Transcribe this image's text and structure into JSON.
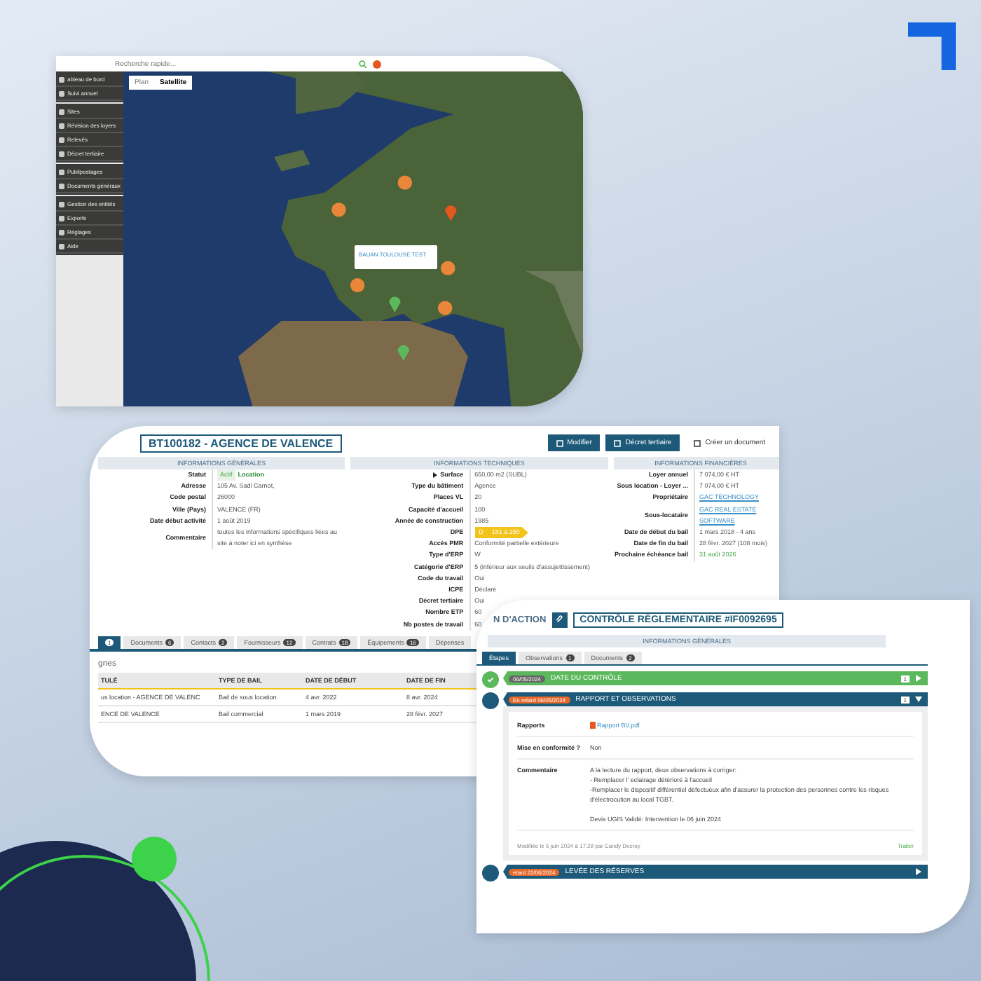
{
  "map_panel": {
    "search": {
      "placeholder": "Recherche rapide..."
    },
    "sidebar_groups": [
      {
        "items": [
          {
            "label": "ableau de bord"
          },
          {
            "label": "Suivi annuel"
          }
        ]
      },
      {
        "items": [
          {
            "label": "Sites"
          },
          {
            "label": "Révision des loyers"
          },
          {
            "label": "Relevés"
          },
          {
            "label": "Décret tertiaire"
          }
        ]
      },
      {
        "items": [
          {
            "label": "Publipostages"
          },
          {
            "label": "Documents généraux"
          }
        ]
      },
      {
        "items": [
          {
            "label": "Gestion des entités"
          },
          {
            "label": "Exports"
          },
          {
            "label": "Réglages"
          },
          {
            "label": "Aide"
          }
        ]
      }
    ],
    "map_tabs": [
      {
        "label": "Plan",
        "selected": false
      },
      {
        "label": "Satellite",
        "selected": true
      }
    ],
    "popup": {
      "title": "BAUAN TOULOUSE TEST"
    }
  },
  "site": {
    "title": "BT100182 - AGENCE DE VALENCE",
    "actions": [
      {
        "label": "Modifier",
        "kind": "primary"
      },
      {
        "label": "Décret tertiaire",
        "kind": "primary"
      },
      {
        "label": "Créer un document",
        "kind": "plain"
      }
    ],
    "sections": [
      {
        "title": "INFORMATIONS GÉNÉRALES",
        "rows": [
          {
            "label": "Statut",
            "kind": "status",
            "badge": "Actif",
            "value": "Location"
          },
          {
            "label": "Adresse",
            "kind": "text",
            "value": "105 Av. Sadi Carnot,"
          },
          {
            "label": "Code postal",
            "kind": "text",
            "value": "26000"
          },
          {
            "label": "Ville (Pays)",
            "kind": "text",
            "value": "VALENCE (FR)"
          },
          {
            "label": "Date début activité",
            "kind": "text",
            "value": "1 août 2019"
          },
          {
            "label": "Commentaire",
            "kind": "text",
            "value": "toutes les informations spécifiques liées au site à noter ici en synthèse"
          }
        ]
      },
      {
        "title": "INFORMATIONS TECHNIQUES",
        "rows": [
          {
            "label": "Surface",
            "kind": "text",
            "value": "650,00 m2 (SUBL)"
          },
          {
            "label": "Type du bâtiment",
            "kind": "text",
            "value": "Agence"
          },
          {
            "label": "Places VL",
            "kind": "text",
            "value": "20"
          },
          {
            "label": "Capacité d'accueil",
            "kind": "text",
            "value": "100"
          },
          {
            "label": "Année de construction",
            "kind": "text",
            "value": "1985"
          },
          {
            "label": "DPE",
            "kind": "dpe",
            "badge": "D",
            "value": "181 à 250"
          },
          {
            "label": "Accès PMR",
            "kind": "text",
            "value": "Conformité partielle extérieure"
          },
          {
            "label": "Type d'ERP",
            "kind": "text",
            "value": "W"
          },
          {
            "label": "Catégorie d'ERP",
            "kind": "text",
            "value": "5 (inférieur aux seuils d'assujettissement)"
          },
          {
            "label": "Code du travail",
            "kind": "text",
            "value": "Oui"
          },
          {
            "label": "ICPE",
            "kind": "text",
            "value": "Déclaré"
          },
          {
            "label": "Décret tertiaire",
            "kind": "text",
            "value": "Oui"
          },
          {
            "label": "Nombre ETP",
            "kind": "text",
            "value": "60"
          },
          {
            "label": "Nb postes de travail",
            "kind": "text",
            "value": "60"
          }
        ]
      },
      {
        "title": "INFORMATIONS FINANCIÈRES",
        "rows": [
          {
            "label": "Loyer annuel",
            "kind": "text",
            "value": "7 074,00 € HT"
          },
          {
            "label": "Sous location - Loyer ...",
            "kind": "text",
            "value": "7 074,00 € HT"
          },
          {
            "label": "Propriétaire",
            "kind": "link",
            "value": "GAC TECHNOLOGY"
          },
          {
            "label": "Sous-locataire",
            "kind": "link",
            "value": "GAC REAL ESTATE SOFTWARE"
          },
          {
            "label": "Date de début du bail",
            "kind": "text",
            "value": "1 mars 2018 - 4 ans"
          },
          {
            "label": "Date de fin du bail",
            "kind": "text",
            "value": "28 févr. 2027 (108 mois)"
          },
          {
            "label": "Prochaine échéance bail",
            "kind": "date",
            "value": "31 août 2026"
          }
        ]
      }
    ],
    "tabs": [
      {
        "badge": "1",
        "selected": true
      },
      {
        "label": "Documents",
        "badge": "6",
        "selected": false
      },
      {
        "label": "Contacts",
        "badge": "2",
        "selected": false
      },
      {
        "label": "Fournisseurs",
        "badge": "12",
        "selected": false
      },
      {
        "label": "Contrats",
        "badge": "18",
        "selected": false
      },
      {
        "label": "Équipements",
        "badge": "16",
        "selected": false
      },
      {
        "label": "Dépenses",
        "selected": false
      }
    ],
    "subtitle": "gnes",
    "table": {
      "columns": [
        "TULÉ",
        "TYPE DE BAIL",
        "DATE DE DÉBUT",
        "DATE DE FIN"
      ],
      "rows": [
        [
          "us location - AGENCE DE VALENC",
          "Bail de sous location",
          "4 avr. 2022",
          "8 avr. 2024"
        ],
        [
          "ENCE DE VALENCE",
          "Bail commercial",
          "1 mars 2019",
          "28 févr. 2027"
        ]
      ]
    }
  },
  "control": {
    "breadcrumb": "N D'ACTION",
    "title": "CONTRÔLE RÉGLEMENTAIRE #IF0092695",
    "section": "INFORMATIONS GÉNÉRALES",
    "tabs": [
      {
        "label": "Étapes",
        "selected": true
      },
      {
        "label": "Observations",
        "badge": "1",
        "selected": false
      },
      {
        "label": "Documents",
        "badge": "2",
        "selected": false
      }
    ],
    "steps": [
      {
        "completed": true,
        "date_badge": "06/05/2024",
        "title": "DATE DU CONTRÔLE",
        "count": "1",
        "expanded": false
      },
      {
        "completed": false,
        "date_badge": "En retard 06/05/2024",
        "title": "RAPPORT ET OBSERVATIONS",
        "count": "1",
        "expanded": true,
        "details": [
          {
            "label": "Rapports",
            "kind": "file",
            "paragraphs": [
              [
                "Rapport BV.pdf"
              ]
            ]
          },
          {
            "label": "Mise en conformité ?",
            "kind": "text",
            "paragraphs": [
              [
                "Non"
              ]
            ]
          },
          {
            "label": "Commentaire",
            "kind": "text",
            "paragraphs": [
              [
                "A la lecture du rapport, deux observations à corriger:",
                "- Remplacer l' eclairage détérioré à l'accueil",
                "-Remplacer le dispositif différentiel défectueux afin d'assurer la protection des personnes contre les risques d'électrocution au local TGBT."
              ],
              [
                "Devis UGIS Validé: Intervention le 06 juin 2024"
              ]
            ]
          }
        ],
        "footer": "Modifiée le 5 juin 2024 à 17:29 par Candy Decroy",
        "action": "Traiter"
      },
      {
        "completed": false,
        "date_badge": "etard 22/06/2024",
        "title": "LEVÉE DES RÉSERVES",
        "expanded": false
      }
    ]
  }
}
